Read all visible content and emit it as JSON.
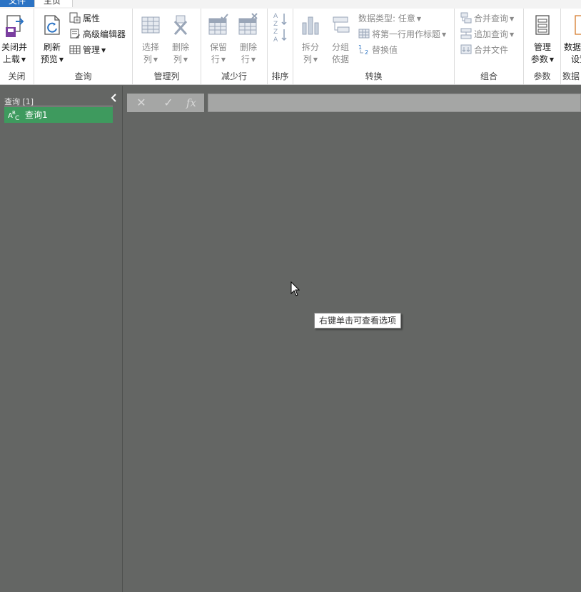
{
  "tabs": {
    "file": "文件",
    "home": "主页"
  },
  "ribbon": {
    "close": {
      "btn_line1": "关闭并",
      "btn_line2": "上载",
      "label": "关闭"
    },
    "query": {
      "refresh_line1": "刷新",
      "refresh_line2": "预览",
      "properties": "属性",
      "advanced_editor": "高级编辑器",
      "manage": "管理",
      "label": "查询"
    },
    "manage_columns": {
      "choose_line1": "选择",
      "choose_line2": "列",
      "remove_line1": "删除",
      "remove_line2": "列",
      "label": "管理列"
    },
    "reduce_rows": {
      "keep_line1": "保留",
      "keep_line2": "行",
      "remove_line1": "删除",
      "remove_line2": "行",
      "label": "减少行"
    },
    "sort": {
      "label": "排序"
    },
    "transform": {
      "split_line1": "拆分",
      "split_line2": "列",
      "group_line1": "分组",
      "group_line2": "依据",
      "data_type": "数据类型: 任意",
      "first_row_headers": "将第一行用作标题",
      "replace_values": "替换值",
      "label": "转换"
    },
    "combine": {
      "merge": "合并查询",
      "append": "追加查询",
      "combine_files": "合并文件",
      "label": "组合"
    },
    "parameters": {
      "btn_line1": "管理",
      "btn_line2": "参数",
      "label": "参数"
    },
    "datasource": {
      "btn_line1": "数据",
      "btn_line2": "设置",
      "label": "数据"
    }
  },
  "query_pane": {
    "title": "查询 [1]",
    "items": [
      {
        "label": "查询1"
      }
    ]
  },
  "formula_bar": {
    "cancel": "✕",
    "confirm": "✓",
    "fx": "fx"
  },
  "tooltip": "右键单击可查看选项",
  "colors": {
    "accent": "#2b73c4",
    "selected_query": "#3e9a5e",
    "workspace": "#646664"
  }
}
